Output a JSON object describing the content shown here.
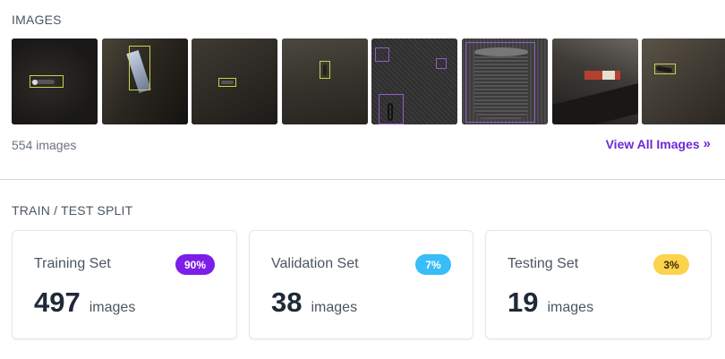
{
  "images_section": {
    "title": "IMAGES",
    "count_text": "554 images",
    "view_all_label": "View All Images",
    "view_all_icon": "double-chevron-right-icon"
  },
  "split_section": {
    "title": "TRAIN / TEST SPLIT",
    "cards": [
      {
        "label": "Training Set",
        "badge": "90%",
        "value": "497",
        "unit": "images",
        "badge_color": "#7c1ee6",
        "badge_text_color": "#ffffff"
      },
      {
        "label": "Validation Set",
        "badge": "7%",
        "value": "38",
        "unit": "images",
        "badge_color": "#38bdf8",
        "badge_text_color": "#ffffff"
      },
      {
        "label": "Testing Set",
        "badge": "3%",
        "value": "19",
        "unit": "images",
        "badge_color": "#fcd34d",
        "badge_text_color": "#3f2d00"
      }
    ]
  },
  "colors": {
    "accent": "#6d28d9",
    "bbox": "#c6d44a",
    "bbox_alt": "#8f5fc8"
  }
}
